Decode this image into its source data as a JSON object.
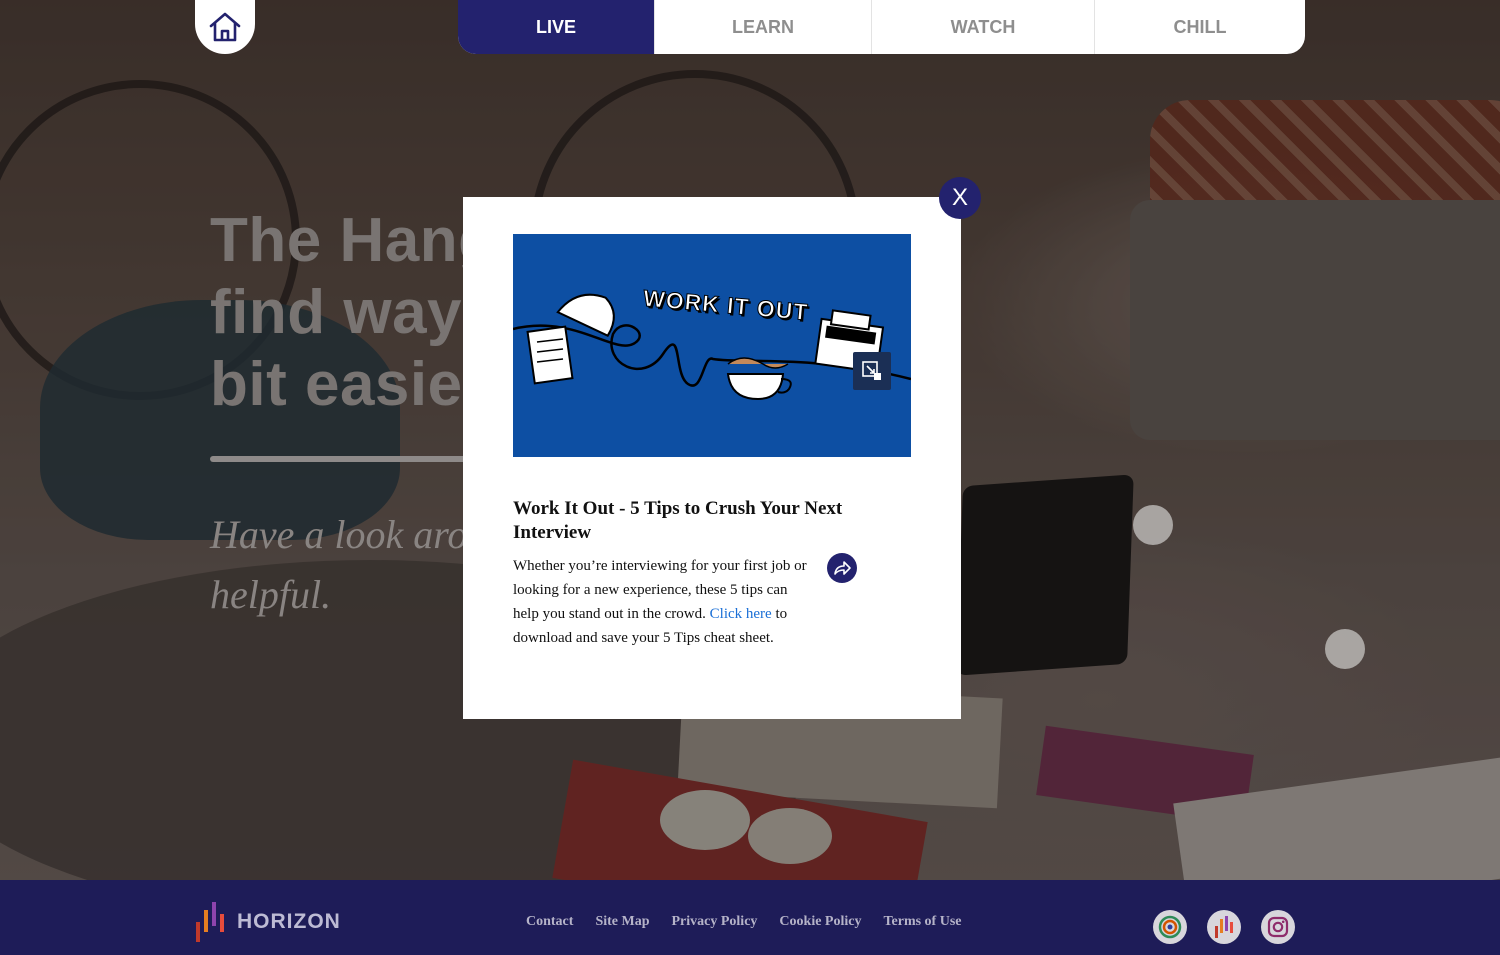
{
  "nav": {
    "home_icon": "home-icon",
    "tabs": [
      {
        "label": "LIVE",
        "active": true
      },
      {
        "label": "LEARN",
        "active": false
      },
      {
        "label": "WATCH",
        "active": false
      },
      {
        "label": "CHILL",
        "active": false
      }
    ]
  },
  "hero": {
    "title": "The Hango\nfind ways t\nbit easier",
    "subtitle": "Have a look aro\nhelpful."
  },
  "modal": {
    "close_label": "X",
    "image_text": "WORK IT OUT",
    "title": "Work It Out - 5 Tips to Crush Your Next Interview",
    "body_before_link": "Whether you’re interviewing for your first job or looking for a new experience, these 5 tips can help you stand out in the crowd. ",
    "link_text": "Click here",
    "body_after_link": " to download and save your 5 Tips cheat sheet.",
    "share_icon": "share-icon",
    "expand_icon": "expand-icon"
  },
  "footer": {
    "brand": "HORIZON",
    "links": [
      "Contact",
      "Site Map",
      "Privacy Policy",
      "Cookie Policy",
      "Terms of Use"
    ],
    "social_icons": [
      "circle-logo-icon",
      "horizon-logo-icon",
      "instagram-icon"
    ]
  },
  "colors": {
    "primary_navy": "#23226e",
    "footer_bg": "#1e1c58",
    "promo_blue": "#0d4fa3",
    "link_blue": "#1a6fd6"
  }
}
